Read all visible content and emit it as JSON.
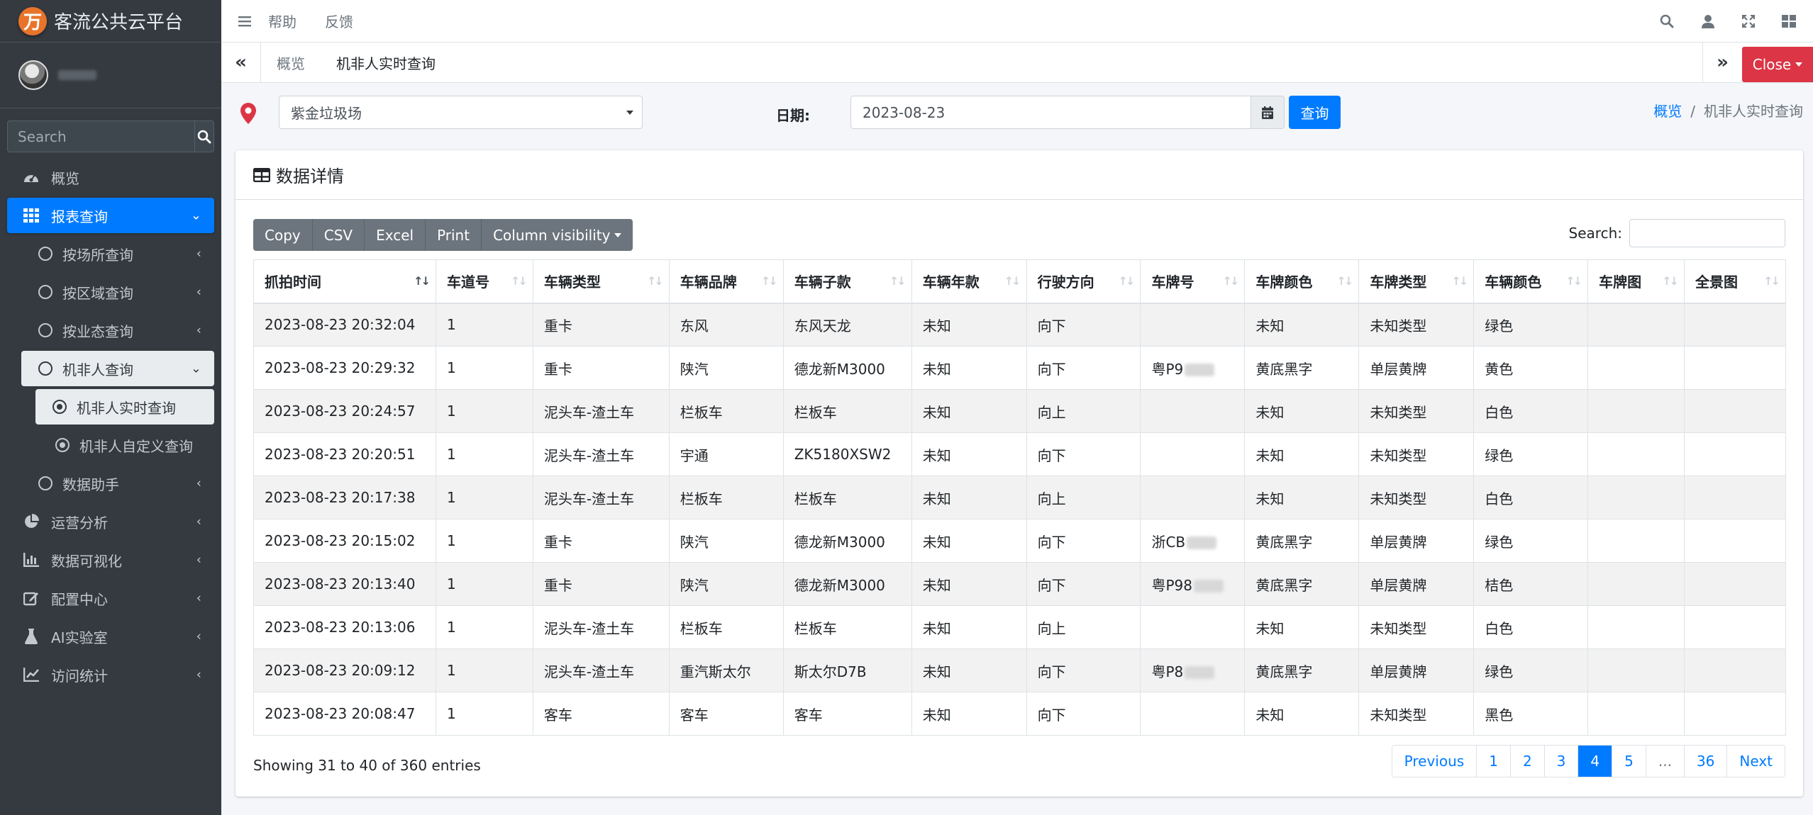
{
  "brand": {
    "logo_char": "万",
    "title": "客流公共云平台"
  },
  "sidebar": {
    "search_placeholder": "Search",
    "nav": [
      {
        "label": "概览",
        "icon": "dashboard-icon"
      },
      {
        "label": "报表查询",
        "icon": "grid-icon"
      },
      {
        "label": "按场所查询"
      },
      {
        "label": "按区域查询"
      },
      {
        "label": "按业态查询"
      },
      {
        "label": "机非人查询"
      },
      {
        "label": "机非人实时查询"
      },
      {
        "label": "机非人自定义查询"
      },
      {
        "label": "数据助手"
      },
      {
        "label": "运营分析",
        "icon": "pie-chart-icon"
      },
      {
        "label": "数据可视化",
        "icon": "bar-chart-icon"
      },
      {
        "label": "配置中心",
        "icon": "edit-icon"
      },
      {
        "label": "AI实验室",
        "icon": "flask-icon"
      },
      {
        "label": "访问统计",
        "icon": "line-chart-icon"
      }
    ]
  },
  "topbar": {
    "help": "帮助",
    "feedback": "反馈"
  },
  "tabs": {
    "overview": "概览",
    "current": "机非人实时查询",
    "close": "Close"
  },
  "filters": {
    "site": "紫金垃圾场",
    "date_label": "日期:",
    "date_value": "2023-08-23",
    "query_button": "查询"
  },
  "breadcrumb": {
    "home": "概览",
    "current": "机非人实时查询"
  },
  "card": {
    "title": "数据详情",
    "buttons": [
      "Copy",
      "CSV",
      "Excel",
      "Print",
      "Column visibility"
    ],
    "search_label": "Search:"
  },
  "table": {
    "headers": [
      "抓拍时间",
      "车道号",
      "车辆类型",
      "车辆品牌",
      "车辆子款",
      "车辆年款",
      "行驶方向",
      "车牌号",
      "车牌颜色",
      "车牌类型",
      "车辆颜色",
      "车牌图",
      "全景图"
    ],
    "rows": [
      [
        "2023-08-23 20:32:04",
        "1",
        "重卡",
        "东风",
        "东风天龙",
        "未知",
        "向下",
        "",
        "未知",
        "未知类型",
        "绿色",
        "",
        ""
      ],
      [
        "2023-08-23 20:29:32",
        "1",
        "重卡",
        "陕汽",
        "德龙新M3000",
        "未知",
        "向下",
        "粤P9",
        "黄底黑字",
        "单层黄牌",
        "黄色",
        "",
        ""
      ],
      [
        "2023-08-23 20:24:57",
        "1",
        "泥头车-渣土车",
        "栏板车",
        "栏板车",
        "未知",
        "向上",
        "",
        "未知",
        "未知类型",
        "白色",
        "",
        ""
      ],
      [
        "2023-08-23 20:20:51",
        "1",
        "泥头车-渣土车",
        "宇通",
        "ZK5180XSW2",
        "未知",
        "向下",
        "",
        "未知",
        "未知类型",
        "绿色",
        "",
        ""
      ],
      [
        "2023-08-23 20:17:38",
        "1",
        "泥头车-渣土车",
        "栏板车",
        "栏板车",
        "未知",
        "向上",
        "",
        "未知",
        "未知类型",
        "白色",
        "",
        ""
      ],
      [
        "2023-08-23 20:15:02",
        "1",
        "重卡",
        "陕汽",
        "德龙新M3000",
        "未知",
        "向下",
        "浙CB",
        "黄底黑字",
        "单层黄牌",
        "绿色",
        "",
        ""
      ],
      [
        "2023-08-23 20:13:40",
        "1",
        "重卡",
        "陕汽",
        "德龙新M3000",
        "未知",
        "向下",
        "粤P98",
        "黄底黑字",
        "单层黄牌",
        "桔色",
        "",
        ""
      ],
      [
        "2023-08-23 20:13:06",
        "1",
        "泥头车-渣土车",
        "栏板车",
        "栏板车",
        "未知",
        "向上",
        "",
        "未知",
        "未知类型",
        "白色",
        "",
        ""
      ],
      [
        "2023-08-23 20:09:12",
        "1",
        "泥头车-渣土车",
        "重汽斯太尔",
        "斯太尔D7B",
        "未知",
        "向下",
        "粤P8",
        "黄底黑字",
        "单层黄牌",
        "绿色",
        "",
        ""
      ],
      [
        "2023-08-23 20:08:47",
        "1",
        "客车",
        "客车",
        "客车",
        "未知",
        "向下",
        "",
        "未知",
        "未知类型",
        "黑色",
        "",
        ""
      ]
    ]
  },
  "footer": {
    "info": "Showing 31 to 40 of 360 entries",
    "pages": [
      "Previous",
      "1",
      "2",
      "3",
      "4",
      "5",
      "...",
      "36",
      "Next"
    ],
    "active_page": "4"
  },
  "colors": {
    "primary": "#007bff",
    "sidebar": "#343a40",
    "danger": "#dc3545",
    "pin": "#dc3545"
  }
}
